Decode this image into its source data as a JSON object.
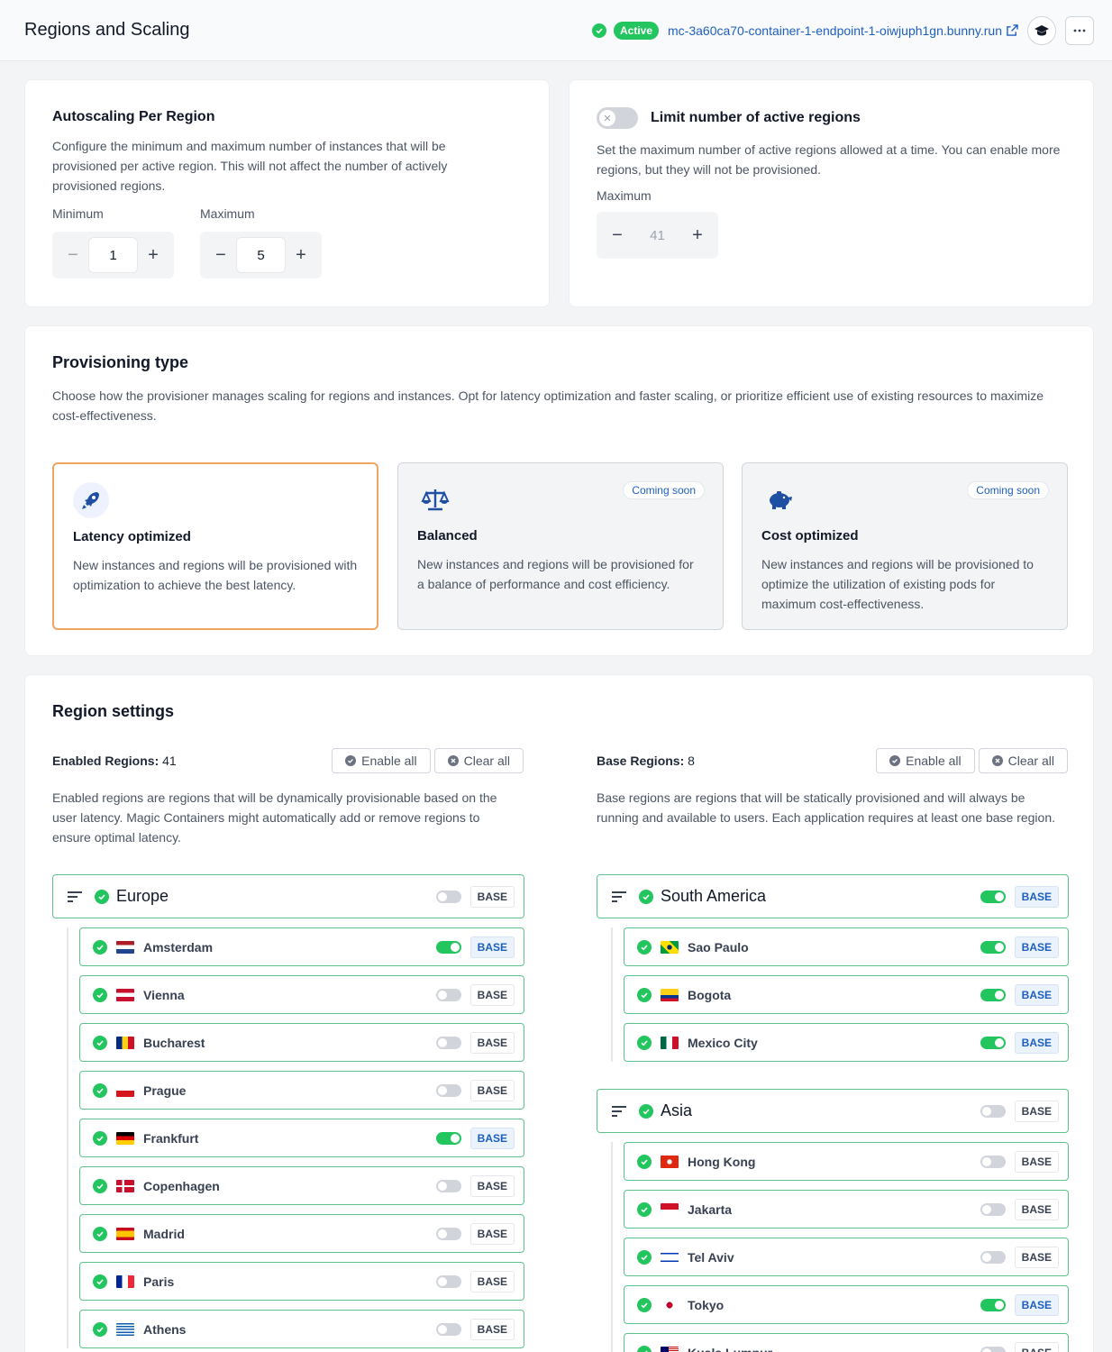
{
  "header": {
    "title": "Regions and Scaling",
    "status": "Active",
    "endpoint": "mc-3a60ca70-container-1-endpoint-1-oiwjuph1gn.bunny.run",
    "icons": [
      "check-circle-icon",
      "external-link-icon",
      "graduation-cap-icon",
      "more-icon"
    ]
  },
  "autoscaling": {
    "title": "Autoscaling Per Region",
    "description": "Configure the minimum and maximum number of instances that will be provisioned per active region. This will not affect the number of actively provisioned regions.",
    "min_label": "Minimum",
    "min_value": "1",
    "max_label": "Maximum",
    "max_value": "5"
  },
  "limit": {
    "title": "Limit number of active regions",
    "description": "Set the maximum number of active regions allowed at a time. You can enable more regions, but they will not be provisioned.",
    "max_label": "Maximum",
    "max_value": "41",
    "enabled": false
  },
  "provisioning": {
    "title": "Provisioning type",
    "description": "Choose how the provisioner manages scaling for regions and instances. Opt for latency optimization and faster scaling, or prioritize efficient use of existing resources to maximize cost-effectiveness.",
    "options": [
      {
        "title": "Latency optimized",
        "description": "New instances and regions will be provisioned with optimization to achieve the best latency.",
        "badge": "",
        "icon": "rocket-icon",
        "selected": true
      },
      {
        "title": "Balanced",
        "description": "New instances and regions will be provisioned for a balance of performance and cost efficiency.",
        "badge": "Coming soon",
        "icon": "scale-icon",
        "selected": false
      },
      {
        "title": "Cost optimized",
        "description": "New instances and regions will be provisioned to optimize the utilization of existing pods for maximum cost-effectiveness.",
        "badge": "Coming soon",
        "icon": "piggy-bank-icon",
        "selected": false
      }
    ]
  },
  "regions": {
    "title": "Region settings",
    "enabled_label": "Enabled Regions:",
    "enabled_count": "41",
    "base_label": "Base Regions:",
    "base_count": "8",
    "enable_all": "Enable all",
    "clear_all": "Clear all",
    "enabled_description": "Enabled regions are regions that will be dynamically provisionable based on the user latency. Magic Containers might automatically add or remove regions to ensure optimal latency.",
    "base_description": "Base regions are regions that will be statically provisioned and will always be running and available to users. Each application requires at least one base region.",
    "base_tag": "BASE",
    "europe": {
      "name": "Europe",
      "base": false,
      "cities": [
        {
          "name": "Amsterdam",
          "base": true,
          "flag": "nl"
        },
        {
          "name": "Vienna",
          "base": false,
          "flag": "at"
        },
        {
          "name": "Bucharest",
          "base": false,
          "flag": "ro"
        },
        {
          "name": "Prague",
          "base": false,
          "flag": "cz"
        },
        {
          "name": "Frankfurt",
          "base": true,
          "flag": "de"
        },
        {
          "name": "Copenhagen",
          "base": false,
          "flag": "dk"
        },
        {
          "name": "Madrid",
          "base": false,
          "flag": "es"
        },
        {
          "name": "Paris",
          "base": false,
          "flag": "fr"
        },
        {
          "name": "Athens",
          "base": false,
          "flag": "gr"
        }
      ]
    },
    "south_america": {
      "name": "South America",
      "base": true,
      "cities": [
        {
          "name": "Sao Paulo",
          "base": true,
          "flag": "br"
        },
        {
          "name": "Bogota",
          "base": true,
          "flag": "co"
        },
        {
          "name": "Mexico City",
          "base": true,
          "flag": "mx"
        }
      ]
    },
    "asia": {
      "name": "Asia",
      "base": false,
      "cities": [
        {
          "name": "Hong Kong",
          "base": false,
          "flag": "hk"
        },
        {
          "name": "Jakarta",
          "base": false,
          "flag": "id"
        },
        {
          "name": "Tel Aviv",
          "base": false,
          "flag": "il"
        },
        {
          "name": "Tokyo",
          "base": true,
          "flag": "jp"
        },
        {
          "name": "Kuala Lumpur",
          "base": false,
          "flag": "my"
        }
      ]
    }
  },
  "colors": {
    "accent": "#1d5fbf",
    "success": "#22c55e",
    "selected_border": "#f0a560"
  }
}
